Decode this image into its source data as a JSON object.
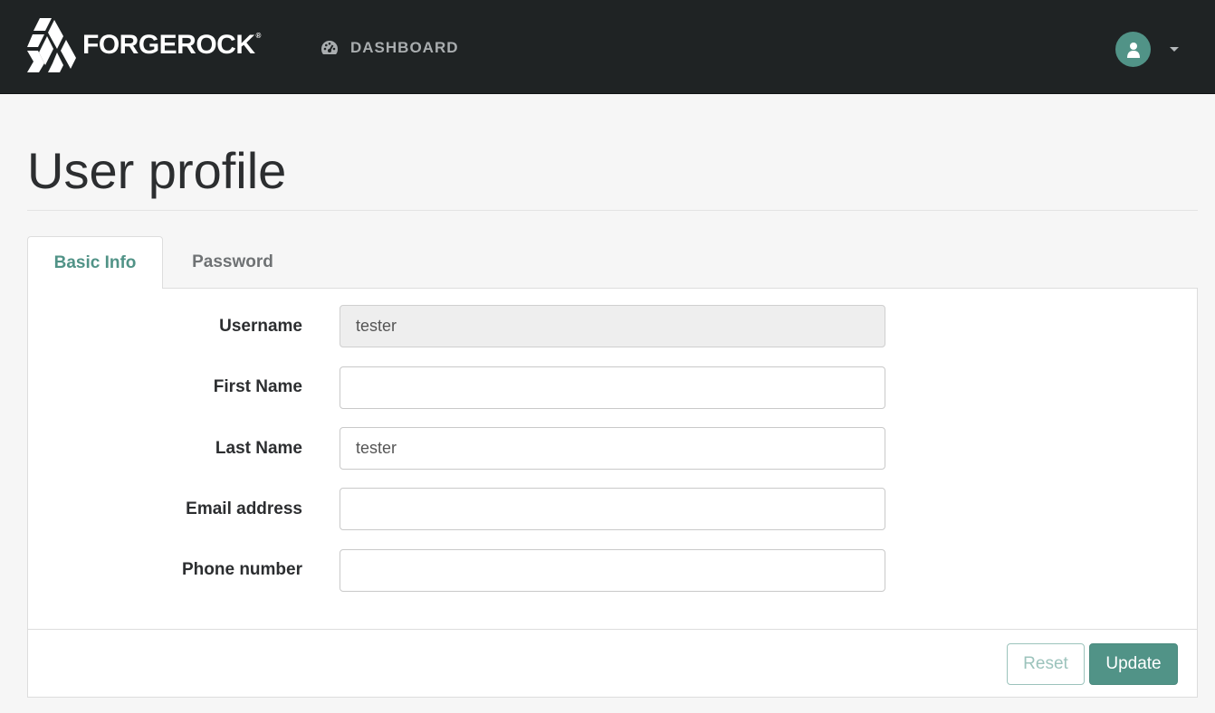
{
  "navbar": {
    "brand_text": "FORGEROCK",
    "brand_mark": "®",
    "dashboard_label": "DASHBOARD",
    "dashboard_icon": "tachometer-icon",
    "user_icon": "user-icon"
  },
  "page": {
    "title": "User profile"
  },
  "tabs": [
    {
      "label": "Basic Info",
      "active": true
    },
    {
      "label": "Password",
      "active": false
    }
  ],
  "form": {
    "fields": [
      {
        "label": "Username",
        "value": "tester",
        "readonly": true
      },
      {
        "label": "First Name",
        "value": "",
        "readonly": false
      },
      {
        "label": "Last Name",
        "value": "tester",
        "readonly": false
      },
      {
        "label": "Email address",
        "value": "",
        "readonly": false
      },
      {
        "label": "Phone number",
        "value": "",
        "readonly": false
      }
    ]
  },
  "actions": {
    "reset_label": "Reset",
    "update_label": "Update"
  },
  "colors": {
    "navbar_bg": "#1f2324",
    "accent": "#519387",
    "page_bg": "#f6f6f6"
  }
}
